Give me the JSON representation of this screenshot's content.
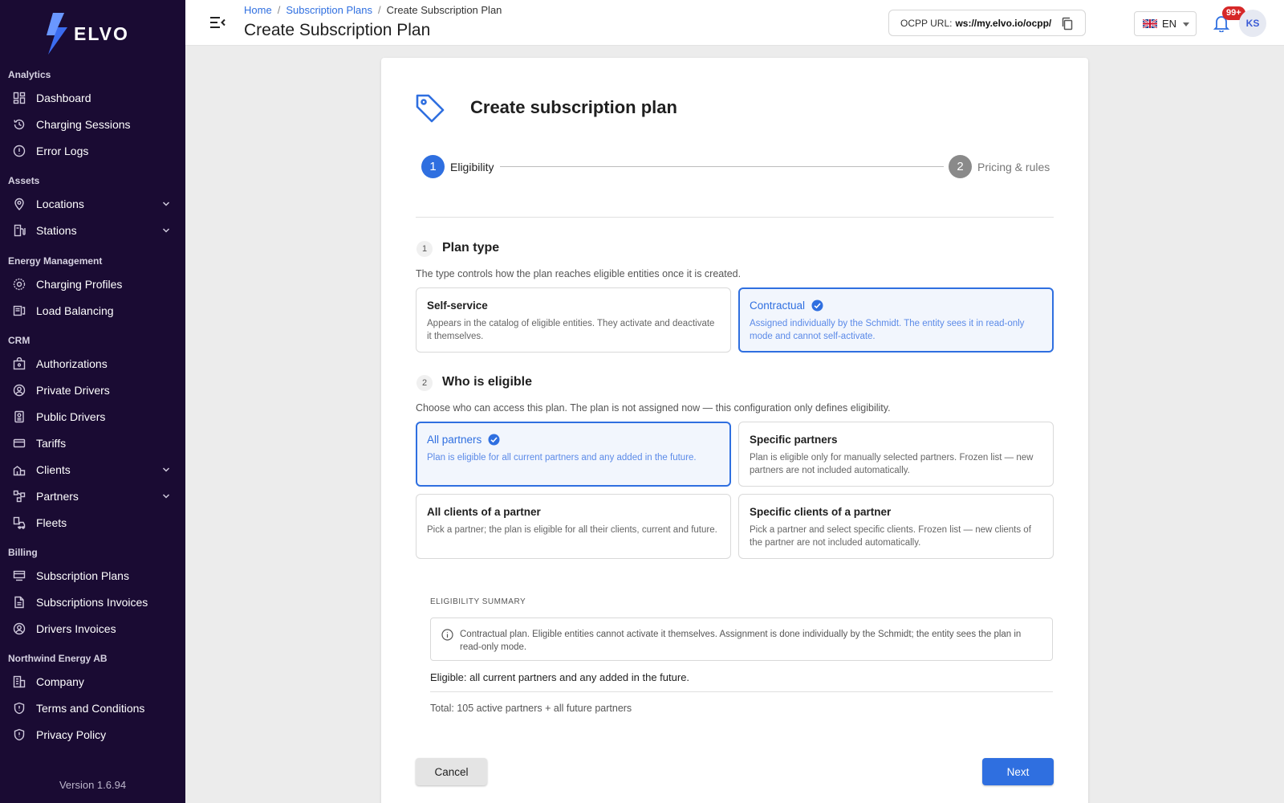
{
  "brand": {
    "name": "ELVO",
    "accent": "#2f6fe0",
    "sidebar_bg": "#1a0b33"
  },
  "sidebar": {
    "sections": [
      {
        "title": "Analytics",
        "items": [
          {
            "label": "Dashboard",
            "icon": "dashboard-icon"
          },
          {
            "label": "Charging Sessions",
            "icon": "history-icon"
          },
          {
            "label": "Error Logs",
            "icon": "alert-icon"
          }
        ]
      },
      {
        "title": "Assets",
        "items": [
          {
            "label": "Locations",
            "icon": "location-pin-icon",
            "expandable": true
          },
          {
            "label": "Stations",
            "icon": "station-icon",
            "expandable": true
          }
        ]
      },
      {
        "title": "Energy Management",
        "items": [
          {
            "label": "Charging Profiles",
            "icon": "profile-gauge-icon"
          },
          {
            "label": "Load Balancing",
            "icon": "load-balancing-icon"
          }
        ]
      },
      {
        "title": "CRM",
        "items": [
          {
            "label": "Authorizations",
            "icon": "authorization-icon"
          },
          {
            "label": "Private Drivers",
            "icon": "user-circle-icon"
          },
          {
            "label": "Public Drivers",
            "icon": "driver-card-icon"
          },
          {
            "label": "Tariffs",
            "icon": "card-icon"
          },
          {
            "label": "Clients",
            "icon": "clients-building-icon",
            "expandable": true
          },
          {
            "label": "Partners",
            "icon": "partners-icon",
            "expandable": true
          },
          {
            "label": "Fleets",
            "icon": "fleet-icon"
          }
        ]
      },
      {
        "title": "Billing",
        "items": [
          {
            "label": "Subscription Plans",
            "icon": "subscription-icon"
          },
          {
            "label": "Subscriptions Invoices",
            "icon": "document-icon"
          },
          {
            "label": "Drivers Invoices",
            "icon": "user-circle-icon"
          }
        ]
      },
      {
        "title": "Northwind Energy AB",
        "items": [
          {
            "label": "Company",
            "icon": "company-icon"
          },
          {
            "label": "Terms and Conditions",
            "icon": "shield-icon"
          },
          {
            "label": "Privacy Policy",
            "icon": "shield-icon"
          }
        ]
      }
    ],
    "version": "Version 1.6.94"
  },
  "header": {
    "breadcrumb": [
      "Home",
      "Subscription Plans",
      "Create Subscription Plan"
    ],
    "title": "Create Subscription Plan",
    "ocpp_label": "OCPP URL:",
    "ocpp_url": "ws://my.elvo.io/ocpp/",
    "language": "EN",
    "notifications": "99+",
    "user_initials": "KS"
  },
  "form": {
    "title": "Create subscription plan",
    "steps": [
      {
        "num": "1",
        "label": "Eligibility"
      },
      {
        "num": "2",
        "label": "Pricing & rules"
      }
    ],
    "plan_type": {
      "num": "1",
      "title": "Plan type",
      "desc": "The type controls how the plan reaches eligible entities once it is created.",
      "options": [
        {
          "title": "Self-service",
          "desc": "Appears in the catalog of eligible entities. They activate and deactivate it themselves."
        },
        {
          "title": "Contractual",
          "desc": "Assigned individually by the Schmidt. The entity sees it in read-only mode and cannot self-activate."
        }
      ],
      "selected": "Contractual"
    },
    "eligible": {
      "num": "2",
      "title": "Who is eligible",
      "desc": "Choose who can access this plan. The plan is not assigned now — this configuration only defines eligibility.",
      "options": [
        {
          "title": "All partners",
          "desc": "Plan is eligible for all current partners and any added in the future."
        },
        {
          "title": "Specific partners",
          "desc": "Plan is eligible only for manually selected partners. Frozen list — new partners are not included automatically."
        },
        {
          "title": "All clients of a partner",
          "desc": "Pick a partner; the plan is eligible for all their clients, current and future."
        },
        {
          "title": "Specific clients of a partner",
          "desc": "Pick a partner and select specific clients. Frozen list — new clients of the partner are not included automatically."
        }
      ],
      "selected": "All partners"
    },
    "summary": {
      "label": "ELIGIBILITY SUMMARY",
      "info": "Contractual plan. Eligible entities cannot activate it themselves. Assignment is done individually by the Schmidt; the entity sees the plan in read-only mode.",
      "eligible": "Eligible: all current partners and any added in the future.",
      "total": "Total: 105 active partners + all future partners"
    },
    "cancel_label": "Cancel",
    "next_label": "Next"
  }
}
